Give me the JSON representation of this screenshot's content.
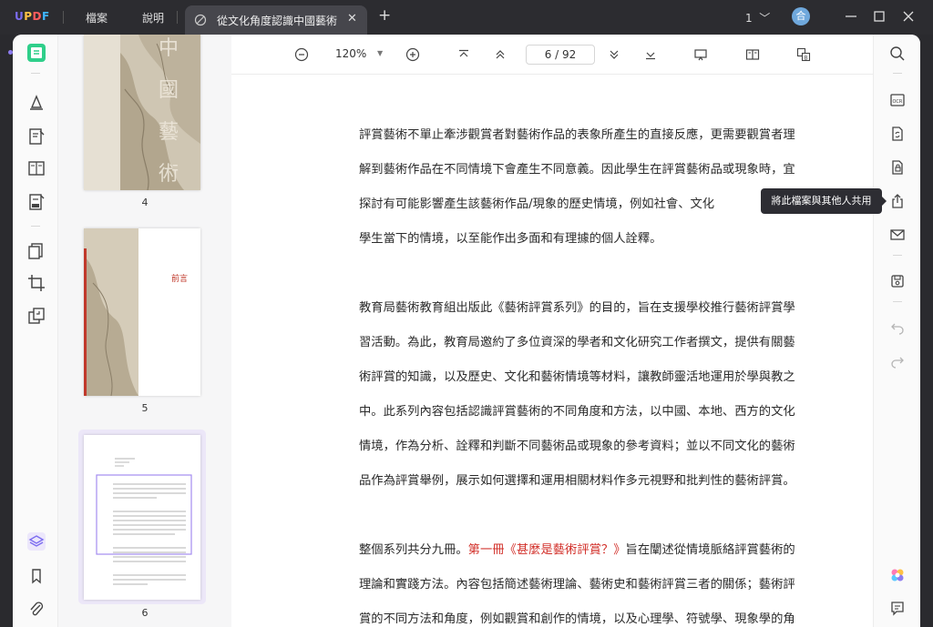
{
  "app": {
    "logo_text": "UPDF",
    "menu": [
      "檔案",
      "說明"
    ],
    "tab_title": "從文化角度認識中國藝術",
    "page_count_label": "1",
    "avatar_initial": "合"
  },
  "toolbar": {
    "zoom": "120%",
    "current_page": "6",
    "total_pages": "92",
    "page_indicator": "6 / 92"
  },
  "thumbnails": [
    {
      "page": "4",
      "title_text": "中國藝術"
    },
    {
      "page": "5",
      "title_text": "前言"
    },
    {
      "page": "6"
    }
  ],
  "tooltip": "將此檔案與其他人共用",
  "document": {
    "paragraphs": [
      {
        "lines": [
          "評賞藝術不單止牽涉觀賞者對藝術作品的表象所產生的直接反應，更需要觀賞者理",
          "解到藝術作品在不同情境下會產生不同意義。因此學生在評賞藝術品或現象時，宜",
          "探討有可能影響產生該藝術作品/現象的歷史情境，例如社會、文化",
          "學生當下的情境，以至能作出多面和有理據的個人詮釋。"
        ]
      },
      {
        "lines": [
          "教育局藝術教育組出版此《藝術評賞系列》的目的，旨在支援學校推行藝術評賞學",
          "習活動。為此，教育局邀約了多位資深的學者和文化研究工作者撰文，提供有關藝",
          "術評賞的知識，以及歷史、文化和藝術情境等材料，讓教師靈活地運用於學與教之",
          "中。此系列內容包括認識評賞藝術的不同角度和方法，以中國、本地、西方的文化",
          "情境，作為分析、詮釋和判斷不同藝術品或現象的參考資料；並以不同文化的藝術",
          "品作為評賞舉例，展示如何選擇和運用相關材料作多元視野和批判性的藝術評賞。"
        ]
      },
      {
        "line1_prefix": "整個系列共分九冊。",
        "line1_red": "第一冊《甚麼是藝術評賞？》",
        "line1_suffix": "旨在闡述從情境脈絡評賞藝術的",
        "lines_rest": [
          "理論和實踐方法。內容包括簡述藝術理論、藝術史和藝術評賞三者的關係；藝術評",
          "賞的不同方法和角度，例如觀賞和創作的情境，以及心理學、符號學、現象學的角"
        ]
      }
    ]
  },
  "colors": {
    "accent": "#7c6cf0",
    "red_text": "#d2302a",
    "titlebar": "#2c2c30"
  }
}
